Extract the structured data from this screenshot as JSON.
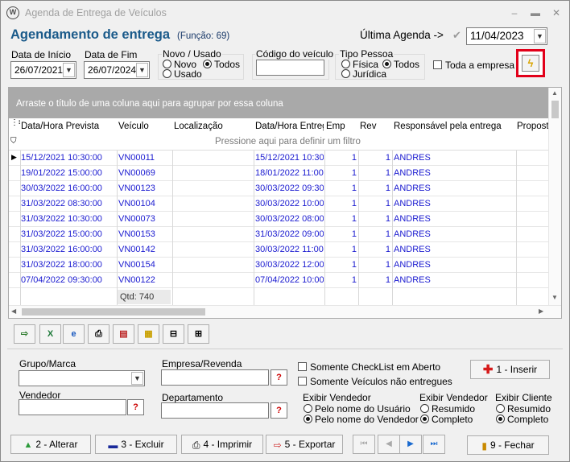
{
  "window": {
    "title": "Agenda de Entrega de Veículos"
  },
  "header": {
    "title": "Agendamento de entrega",
    "function": "(Função: 69)",
    "last_agenda_label": "Última Agenda ->",
    "last_agenda_date": "11/04/2023"
  },
  "filters": {
    "start_date_label": "Data de Início",
    "start_date": "26/07/2021",
    "end_date_label": "Data de Fim",
    "end_date": "26/07/2024",
    "new_used_label": "Novo / Usado",
    "new_label": "Novo",
    "used_label": "Usado",
    "all_label": "Todos",
    "vehicle_code_label": "Código do veículo",
    "vehicle_code": "",
    "person_type_label": "Tipo Pessoa",
    "physical_label": "Física",
    "legal_label": "Jurídica",
    "person_all_label": "Todos",
    "whole_company_label": "Toda a empresa"
  },
  "grid": {
    "group_panel_text": "Arraste o título de uma coluna aqui para agrupar por essa coluna",
    "filter_row_text": "Pressione aqui para definir um filtro",
    "columns": [
      "Data/Hora Prevista",
      "Veículo",
      "Localização",
      "Data/Hora Entreg",
      "Emp",
      "Rev",
      "Responsável pela entrega",
      "Proposta"
    ],
    "rows": [
      {
        "prev": "15/12/2021 10:30:00",
        "veic": "VN00011",
        "loc": "",
        "entreg": "15/12/2021 10:30",
        "emp": "1",
        "rev": "1",
        "resp": "ANDRES"
      },
      {
        "prev": "19/01/2022 15:00:00",
        "veic": "VN00069",
        "loc": "",
        "entreg": "18/01/2022 11:00",
        "emp": "1",
        "rev": "1",
        "resp": "ANDRES"
      },
      {
        "prev": "30/03/2022 16:00:00",
        "veic": "VN00123",
        "loc": "",
        "entreg": "30/03/2022 09:30",
        "emp": "1",
        "rev": "1",
        "resp": "ANDRES"
      },
      {
        "prev": "31/03/2022 08:30:00",
        "veic": "VN00104",
        "loc": "",
        "entreg": "30/03/2022 10:00",
        "emp": "1",
        "rev": "1",
        "resp": "ANDRES"
      },
      {
        "prev": "31/03/2022 10:30:00",
        "veic": "VN00073",
        "loc": "",
        "entreg": "30/03/2022 08:00",
        "emp": "1",
        "rev": "1",
        "resp": "ANDRES"
      },
      {
        "prev": "31/03/2022 15:00:00",
        "veic": "VN00153",
        "loc": "",
        "entreg": "31/03/2022 09:00",
        "emp": "1",
        "rev": "1",
        "resp": "ANDRES"
      },
      {
        "prev": "31/03/2022 16:00:00",
        "veic": "VN00142",
        "loc": "",
        "entreg": "30/03/2022 11:00",
        "emp": "1",
        "rev": "1",
        "resp": "ANDRES"
      },
      {
        "prev": "31/03/2022 18:00:00",
        "veic": "VN00154",
        "loc": "",
        "entreg": "30/03/2022 12:00",
        "emp": "1",
        "rev": "1",
        "resp": "ANDRES"
      },
      {
        "prev": "07/04/2022 09:30:00",
        "veic": "VN00122",
        "loc": "",
        "entreg": "07/04/2022 10:00",
        "emp": "1",
        "rev": "1",
        "resp": "ANDRES"
      }
    ],
    "qtd": "Qtd: 740"
  },
  "bottom": {
    "group_brand_label": "Grupo/Marca",
    "company_label": "Empresa/Revenda",
    "seller_label": "Vendedor",
    "department_label": "Departamento",
    "only_checklist_label": "Somente CheckList em Aberto",
    "only_not_delivered_label": "Somente Veículos não entregues",
    "insert_label": "1 - Inserir",
    "show_seller_label": "Exibir Vendedor",
    "by_user_name": "Pelo nome do Usuário",
    "by_seller_name": "Pelo nome do Vendedor",
    "show_seller2_label": "Exibir Vendedor",
    "summary": "Resumido",
    "complete": "Completo",
    "show_client_label": "Exibir Cliente",
    "summary2": "Resumido",
    "complete2": "Completo",
    "lookup_label": "?"
  },
  "actions": {
    "alter": "2 - Alterar",
    "delete": "3 - Excluir",
    "print": "4 - Imprimir",
    "export": "5 - Exportar",
    "close": "9 - Fechar"
  }
}
